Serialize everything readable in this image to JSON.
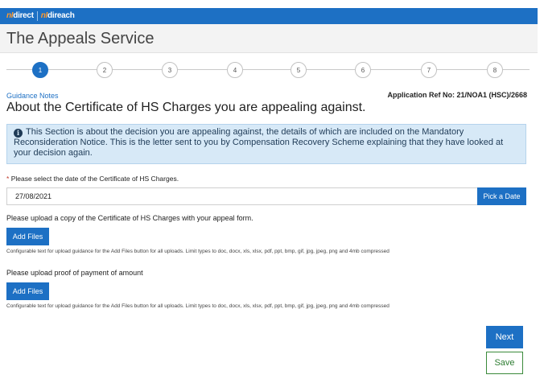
{
  "header": {
    "logo_prefix_1": "nI",
    "logo_brand_1": "direct",
    "logo_prefix_2": "nI",
    "logo_brand_2": "direach",
    "app_title": "The Appeals Service"
  },
  "stepper": {
    "steps": [
      "1",
      "2",
      "3",
      "4",
      "5",
      "6",
      "7",
      "8"
    ],
    "current_step": 1
  },
  "page": {
    "guidance_link": "Guidance Notes",
    "application_ref": "Application Ref No: 21/NOA1 (HSC)/2668",
    "heading": "About the Certificate of HS Charges you are appealing against.",
    "info_text": "This Section is about the decision you are appealing against, the details of which are included on the Mandatory Reconsideration Notice. This is the letter sent to you by Compensation Recovery Scheme explaining that they have looked at your decision again."
  },
  "date_field": {
    "required_marker": "*",
    "label": "Please select the date of the Certificate of HS Charges.",
    "value": "27/08/2021",
    "pick_button": "Pick a Date"
  },
  "upload_certificate": {
    "label": "Please upload a copy of the Certificate of HS Charges with your appeal form.",
    "button": "Add Files",
    "help": "Configurable text for upload guidance for the Add Files button for all uploads. Limit types to doc, docx, xls, xlsx, pdf, ppt, bmp, gif, jpg, jpeg, png and 4mb compressed"
  },
  "upload_payment": {
    "label": "Please upload proof of payment of amount",
    "button": "Add Files",
    "help": "Configurable text for upload guidance for the Add Files button for all uploads. Limit types to doc, docx, xls, xlsx, pdf, ppt, bmp, gif, jpg, jpeg, png and 4mb compressed"
  },
  "actions": {
    "next": "Next",
    "save": "Save"
  },
  "colors": {
    "primary": "#1d70c4",
    "info_background": "#d7e9f7",
    "save_border": "#3a8a3a"
  }
}
